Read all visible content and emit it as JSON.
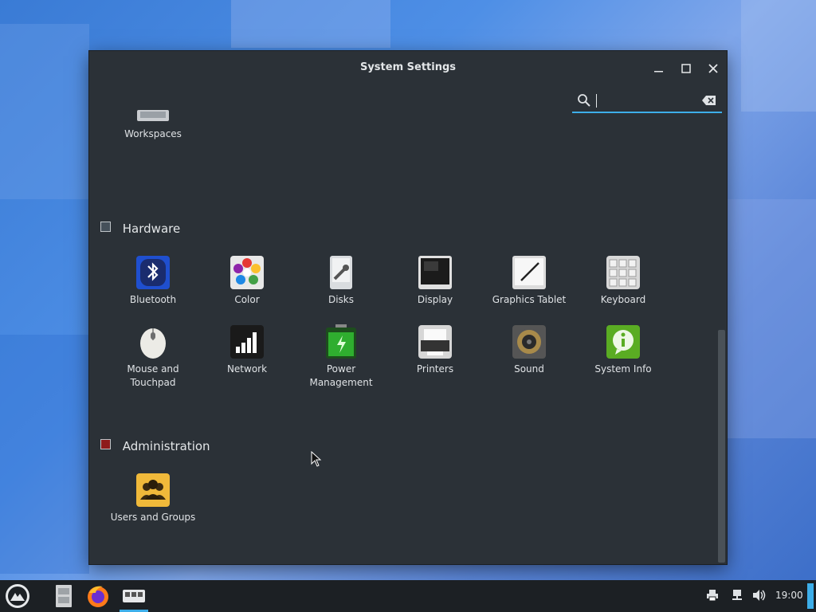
{
  "window": {
    "title": "System Settings",
    "controls": {
      "minimize": "minimize",
      "maximize": "maximize",
      "close": "close"
    }
  },
  "search": {
    "value": "",
    "placeholder": ""
  },
  "sections": {
    "personalization_partial": {
      "items": [
        {
          "label": "Workspaces",
          "icon": "workspaces-icon"
        }
      ]
    },
    "hardware": {
      "title": "Hardware",
      "items": [
        {
          "label": "Bluetooth",
          "icon": "bluetooth-icon"
        },
        {
          "label": "Color",
          "icon": "color-icon"
        },
        {
          "label": "Disks",
          "icon": "disks-icon"
        },
        {
          "label": "Display",
          "icon": "display-icon"
        },
        {
          "label": "Graphics Tablet",
          "icon": "graphics-tablet-icon"
        },
        {
          "label": "Keyboard",
          "icon": "keyboard-icon"
        },
        {
          "label": "Mouse and Touchpad",
          "icon": "mouse-icon"
        },
        {
          "label": "Network",
          "icon": "network-icon"
        },
        {
          "label": "Power Management",
          "icon": "battery-icon"
        },
        {
          "label": "Printers",
          "icon": "printer-icon"
        },
        {
          "label": "Sound",
          "icon": "speaker-icon"
        },
        {
          "label": "System Info",
          "icon": "info-icon"
        }
      ]
    },
    "administration": {
      "title": "Administration",
      "items": [
        {
          "label": "Users and Groups",
          "icon": "users-icon"
        }
      ]
    }
  },
  "taskbar": {
    "clock": "19:00",
    "launchers": [
      "app-menu-icon",
      "file-manager-icon",
      "firefox-icon",
      "system-settings-icon"
    ],
    "tray": [
      "printer-icon",
      "network-icon",
      "volume-icon"
    ]
  },
  "colors": {
    "accent": "#3daee9",
    "window_bg": "#2b3137",
    "taskbar_bg": "#1c2024"
  }
}
